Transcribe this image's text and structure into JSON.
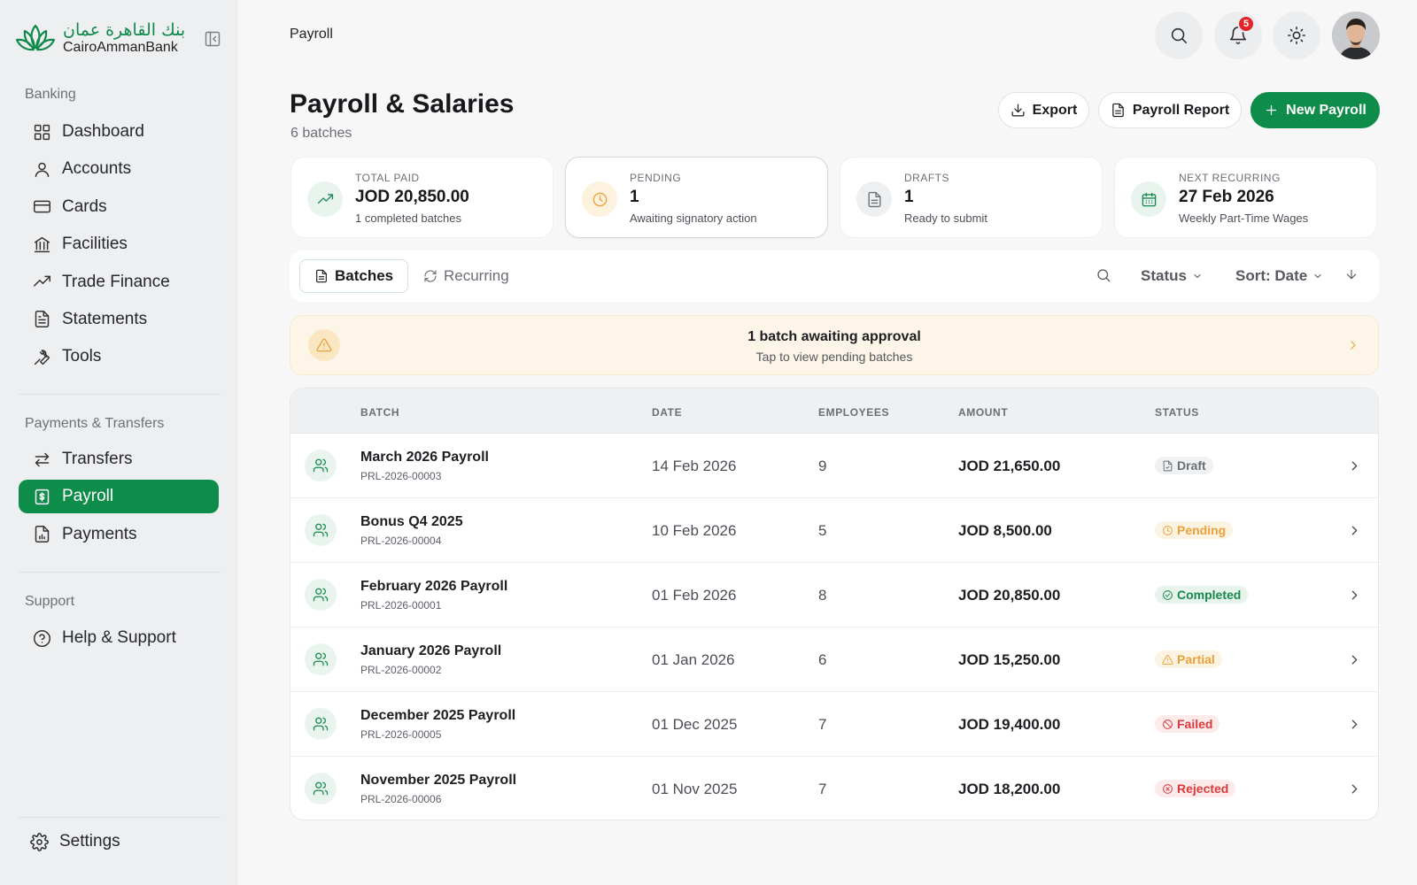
{
  "brand": {
    "name_ar": "بنك القاهرة عمان",
    "name_en": "CairoAmmanBank",
    "color": "#0e8c49"
  },
  "sidebar": {
    "sections": [
      {
        "title": "Banking",
        "items": [
          {
            "label": "Dashboard",
            "icon": "grid-icon"
          },
          {
            "label": "Accounts",
            "icon": "user-icon"
          },
          {
            "label": "Cards",
            "icon": "credit-card-icon"
          },
          {
            "label": "Facilities",
            "icon": "bank-icon"
          },
          {
            "label": "Trade Finance",
            "icon": "trending-up-icon"
          },
          {
            "label": "Statements",
            "icon": "file-text-icon"
          },
          {
            "label": "Tools",
            "icon": "wrench-icon"
          }
        ]
      },
      {
        "title": "Payments & Transfers",
        "items": [
          {
            "label": "Transfers",
            "icon": "arrows-left-right-icon"
          },
          {
            "label": "Payroll",
            "icon": "dollar-file-icon",
            "active": true
          },
          {
            "label": "Payments",
            "icon": "receipt-icon"
          }
        ]
      },
      {
        "title": "Support",
        "items": [
          {
            "label": "Help & Support",
            "icon": "help-circle-icon"
          }
        ]
      }
    ],
    "settings_label": "Settings"
  },
  "topbar": {
    "breadcrumb": "Payroll",
    "notification_count": "5"
  },
  "header": {
    "title": "Payroll & Salaries",
    "subtitle": "6 batches",
    "export_label": "Export",
    "report_label": "Payroll Report",
    "new_label": "New Payroll"
  },
  "stats": [
    {
      "label": "TOTAL PAID",
      "value": "JOD 20,850.00",
      "sub": "1 completed batches",
      "icon": "trending-up-icon",
      "color": "#18894f",
      "bg": "#e8f4ed"
    },
    {
      "label": "PENDING",
      "value": "1",
      "sub": "Awaiting signatory action",
      "icon": "clock-icon",
      "color": "#e9a23b",
      "bg": "#fdf2de"
    },
    {
      "label": "DRAFTS",
      "value": "1",
      "sub": "Ready to submit",
      "icon": "file-icon",
      "color": "#6b6e76",
      "bg": "#eeeff1"
    },
    {
      "label": "NEXT RECURRING",
      "value": "27 Feb 2026",
      "sub": "Weekly Part-Time Wages",
      "icon": "calendar-icon",
      "color": "#18894f",
      "bg": "#e8f4ed"
    }
  ],
  "tabs": {
    "batches": "Batches",
    "recurring": "Recurring"
  },
  "filters": {
    "status": "Status",
    "sort": "Sort: Date"
  },
  "alert": {
    "title": "1 batch awaiting approval",
    "subtitle": "Tap to view pending batches"
  },
  "table": {
    "columns": {
      "batch": "BATCH",
      "date": "DATE",
      "employees": "EMPLOYEES",
      "amount": "AMOUNT",
      "status": "STATUS"
    },
    "rows": [
      {
        "name": "March 2026 Payroll",
        "id": "PRL-2026-00003",
        "date": "14 Feb 2026",
        "employees": "9",
        "amount": "JOD 21,650.00",
        "status": "Draft",
        "status_icon": "file-icon",
        "status_color": "#6b6e76",
        "status_bg": "#f0f1f3"
      },
      {
        "name": "Bonus Q4 2025",
        "id": "PRL-2026-00004",
        "date": "10 Feb 2026",
        "employees": "5",
        "amount": "JOD 8,500.00",
        "status": "Pending",
        "status_icon": "clock-icon",
        "status_color": "#e9a23b",
        "status_bg": "#fdf3e2"
      },
      {
        "name": "February 2026 Payroll",
        "id": "PRL-2026-00001",
        "date": "01 Feb 2026",
        "employees": "8",
        "amount": "JOD 20,850.00",
        "status": "Completed",
        "status_icon": "check-circle-icon",
        "status_color": "#17884d",
        "status_bg": "#e6f4ec"
      },
      {
        "name": "January 2026 Payroll",
        "id": "PRL-2026-00002",
        "date": "01 Jan 2026",
        "employees": "6",
        "amount": "JOD 15,250.00",
        "status": "Partial",
        "status_icon": "alert-triangle-icon",
        "status_color": "#e9a23b",
        "status_bg": "#fdf3e2"
      },
      {
        "name": "December 2025 Payroll",
        "id": "PRL-2026-00005",
        "date": "01 Dec 2025",
        "employees": "7",
        "amount": "JOD 19,400.00",
        "status": "Failed",
        "status_icon": "ban-icon",
        "status_color": "#d93b3b",
        "status_bg": "#fdeaea"
      },
      {
        "name": "November 2025 Payroll",
        "id": "PRL-2026-00006",
        "date": "01 Nov 2025",
        "employees": "7",
        "amount": "JOD 18,200.00",
        "status": "Rejected",
        "status_icon": "x-circle-icon",
        "status_color": "#d93b3b",
        "status_bg": "#fdeaea"
      }
    ]
  }
}
